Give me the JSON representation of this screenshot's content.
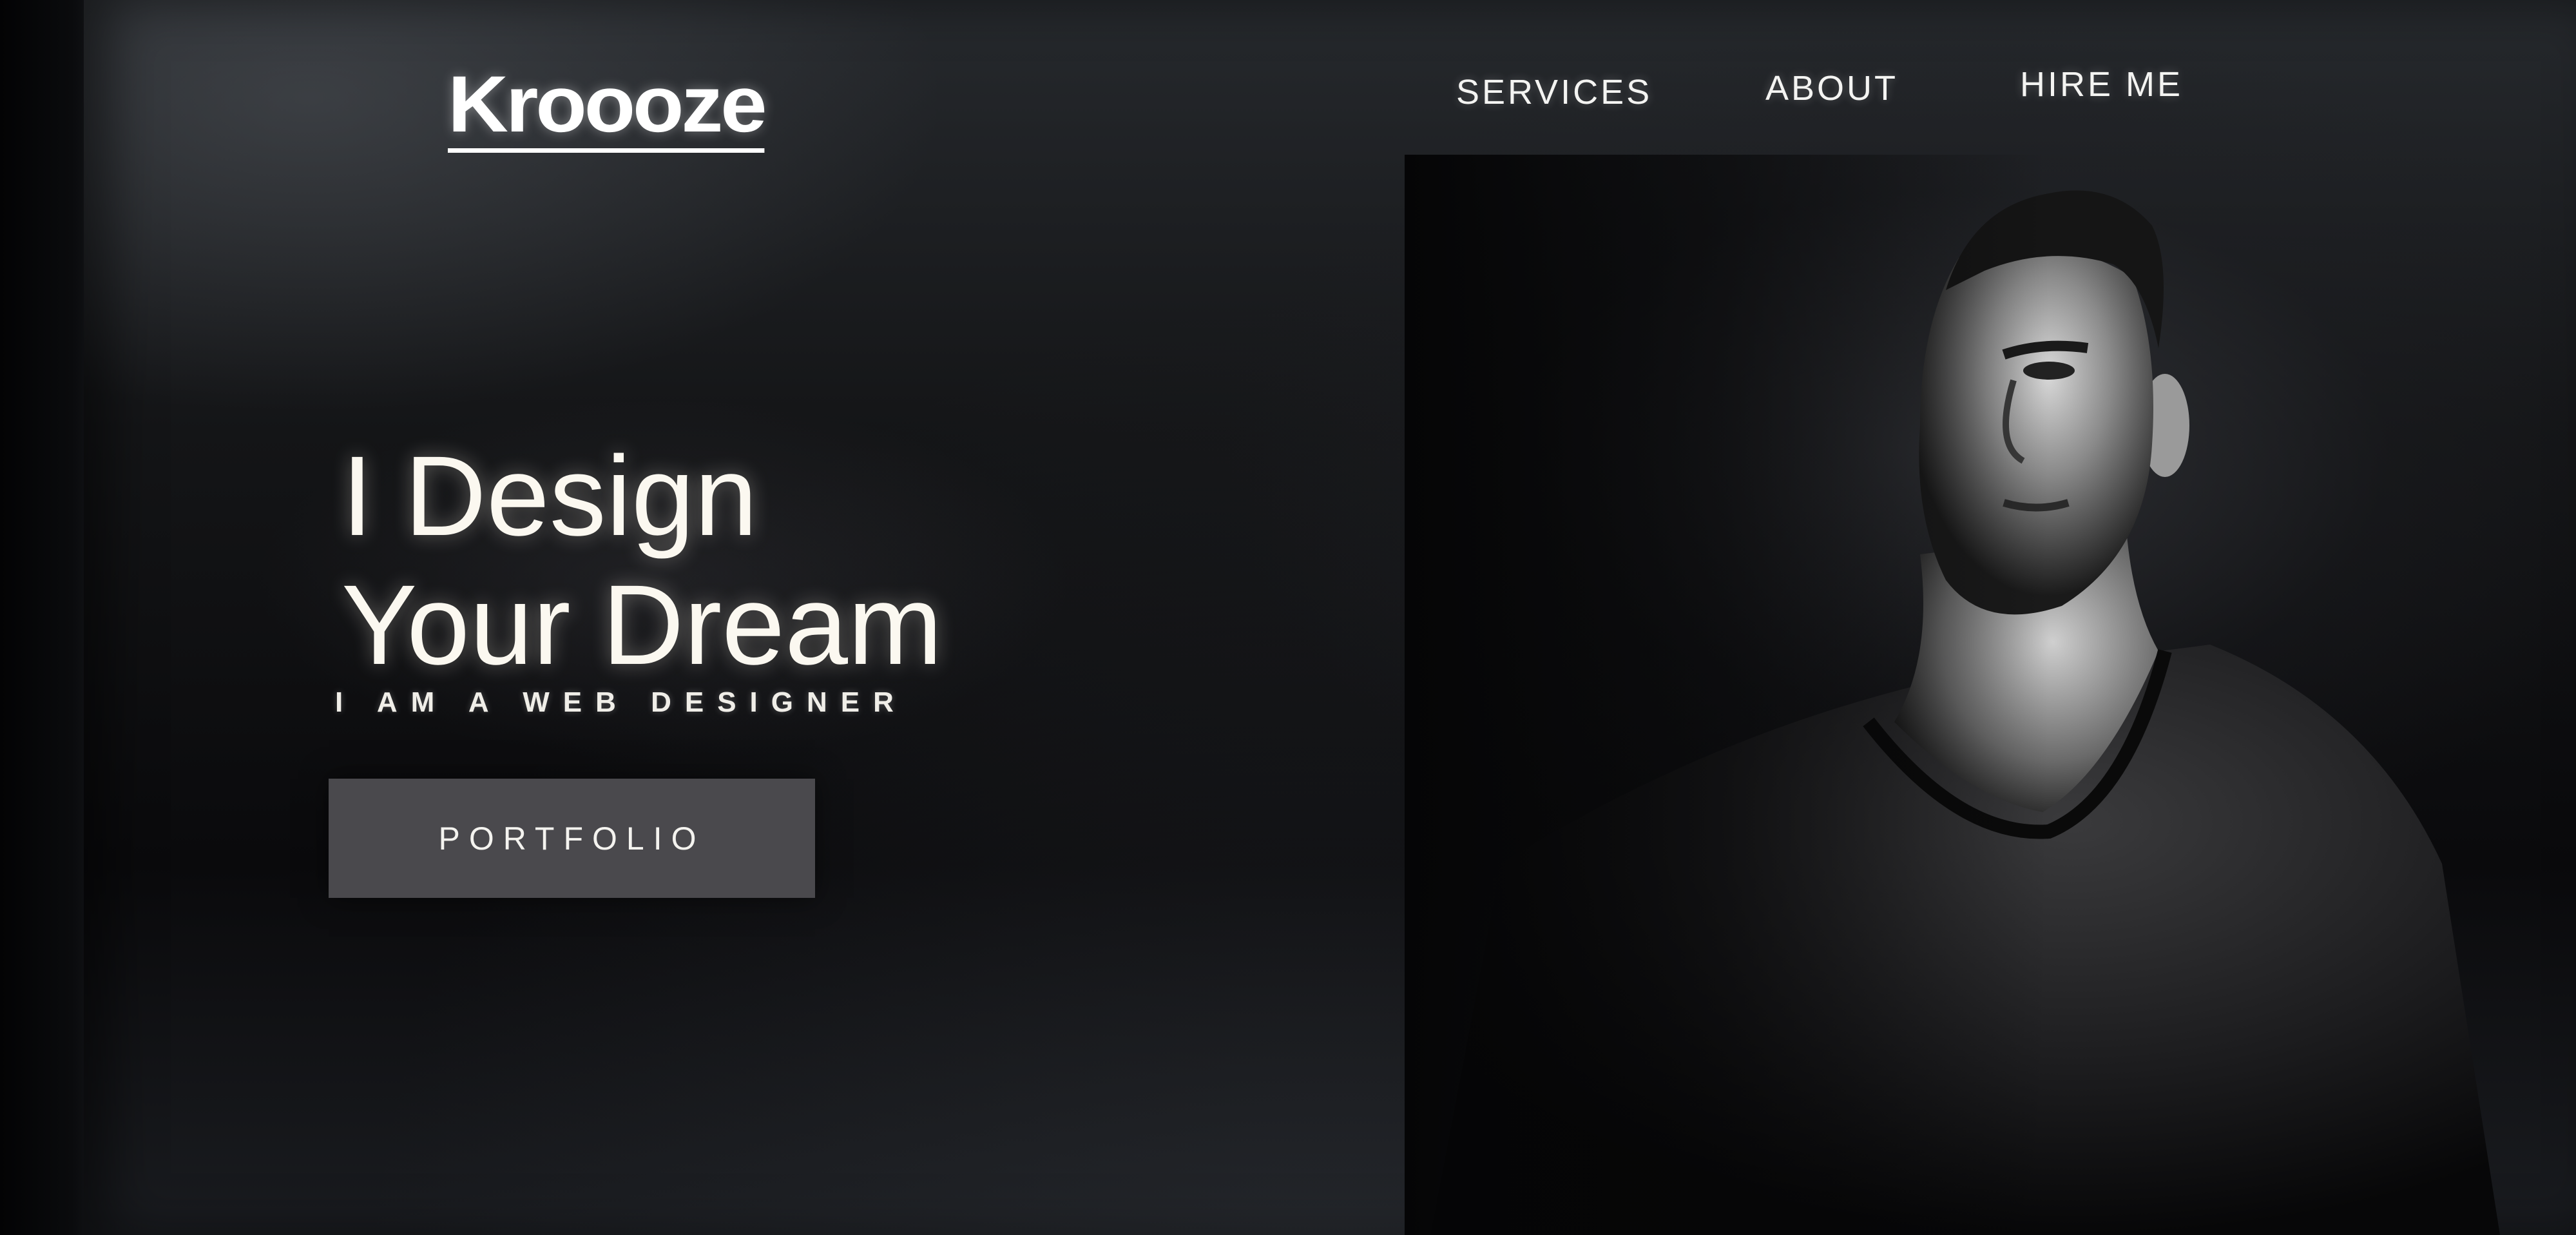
{
  "brand": {
    "logo": "Kroooze"
  },
  "nav": {
    "items": [
      {
        "label": "SERVICES"
      },
      {
        "label": "ABOUT"
      },
      {
        "label": "HIRE ME"
      }
    ]
  },
  "hero": {
    "title_line1": "I Design",
    "title_line2": "Your Dream",
    "subtitle": "I AM A WEB DESIGNER",
    "cta_label": "PORTFOLIO"
  },
  "colors": {
    "background": "#0a0a0c",
    "text": "#f2f2f0",
    "button_bg": "#4a494d"
  }
}
